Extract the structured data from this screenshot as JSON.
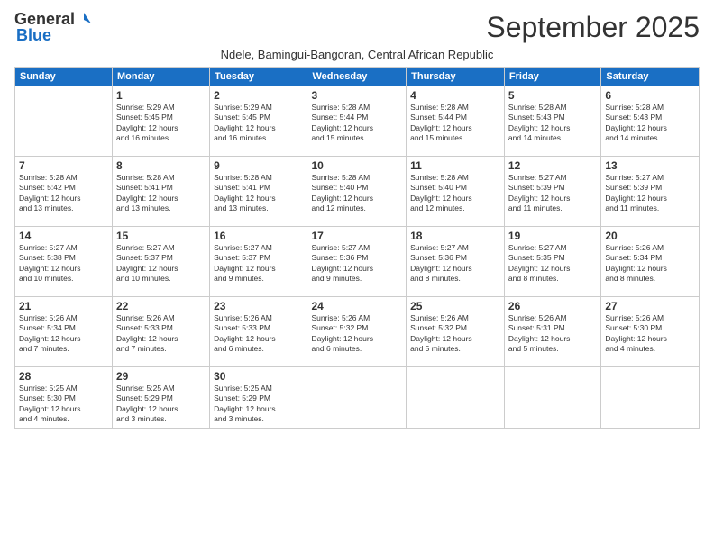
{
  "logo": {
    "general": "General",
    "blue": "Blue"
  },
  "title": "September 2025",
  "subtitle": "Ndele, Bamingui-Bangoran, Central African Republic",
  "days_of_week": [
    "Sunday",
    "Monday",
    "Tuesday",
    "Wednesday",
    "Thursday",
    "Friday",
    "Saturday"
  ],
  "weeks": [
    [
      {
        "day": "",
        "detail": ""
      },
      {
        "day": "1",
        "detail": "Sunrise: 5:29 AM\nSunset: 5:45 PM\nDaylight: 12 hours\nand 16 minutes."
      },
      {
        "day": "2",
        "detail": "Sunrise: 5:29 AM\nSunset: 5:45 PM\nDaylight: 12 hours\nand 16 minutes."
      },
      {
        "day": "3",
        "detail": "Sunrise: 5:28 AM\nSunset: 5:44 PM\nDaylight: 12 hours\nand 15 minutes."
      },
      {
        "day": "4",
        "detail": "Sunrise: 5:28 AM\nSunset: 5:44 PM\nDaylight: 12 hours\nand 15 minutes."
      },
      {
        "day": "5",
        "detail": "Sunrise: 5:28 AM\nSunset: 5:43 PM\nDaylight: 12 hours\nand 14 minutes."
      },
      {
        "day": "6",
        "detail": "Sunrise: 5:28 AM\nSunset: 5:43 PM\nDaylight: 12 hours\nand 14 minutes."
      }
    ],
    [
      {
        "day": "7",
        "detail": "Sunrise: 5:28 AM\nSunset: 5:42 PM\nDaylight: 12 hours\nand 13 minutes."
      },
      {
        "day": "8",
        "detail": "Sunrise: 5:28 AM\nSunset: 5:41 PM\nDaylight: 12 hours\nand 13 minutes."
      },
      {
        "day": "9",
        "detail": "Sunrise: 5:28 AM\nSunset: 5:41 PM\nDaylight: 12 hours\nand 13 minutes."
      },
      {
        "day": "10",
        "detail": "Sunrise: 5:28 AM\nSunset: 5:40 PM\nDaylight: 12 hours\nand 12 minutes."
      },
      {
        "day": "11",
        "detail": "Sunrise: 5:28 AM\nSunset: 5:40 PM\nDaylight: 12 hours\nand 12 minutes."
      },
      {
        "day": "12",
        "detail": "Sunrise: 5:27 AM\nSunset: 5:39 PM\nDaylight: 12 hours\nand 11 minutes."
      },
      {
        "day": "13",
        "detail": "Sunrise: 5:27 AM\nSunset: 5:39 PM\nDaylight: 12 hours\nand 11 minutes."
      }
    ],
    [
      {
        "day": "14",
        "detail": "Sunrise: 5:27 AM\nSunset: 5:38 PM\nDaylight: 12 hours\nand 10 minutes."
      },
      {
        "day": "15",
        "detail": "Sunrise: 5:27 AM\nSunset: 5:37 PM\nDaylight: 12 hours\nand 10 minutes."
      },
      {
        "day": "16",
        "detail": "Sunrise: 5:27 AM\nSunset: 5:37 PM\nDaylight: 12 hours\nand 9 minutes."
      },
      {
        "day": "17",
        "detail": "Sunrise: 5:27 AM\nSunset: 5:36 PM\nDaylight: 12 hours\nand 9 minutes."
      },
      {
        "day": "18",
        "detail": "Sunrise: 5:27 AM\nSunset: 5:36 PM\nDaylight: 12 hours\nand 8 minutes."
      },
      {
        "day": "19",
        "detail": "Sunrise: 5:27 AM\nSunset: 5:35 PM\nDaylight: 12 hours\nand 8 minutes."
      },
      {
        "day": "20",
        "detail": "Sunrise: 5:26 AM\nSunset: 5:34 PM\nDaylight: 12 hours\nand 8 minutes."
      }
    ],
    [
      {
        "day": "21",
        "detail": "Sunrise: 5:26 AM\nSunset: 5:34 PM\nDaylight: 12 hours\nand 7 minutes."
      },
      {
        "day": "22",
        "detail": "Sunrise: 5:26 AM\nSunset: 5:33 PM\nDaylight: 12 hours\nand 7 minutes."
      },
      {
        "day": "23",
        "detail": "Sunrise: 5:26 AM\nSunset: 5:33 PM\nDaylight: 12 hours\nand 6 minutes."
      },
      {
        "day": "24",
        "detail": "Sunrise: 5:26 AM\nSunset: 5:32 PM\nDaylight: 12 hours\nand 6 minutes."
      },
      {
        "day": "25",
        "detail": "Sunrise: 5:26 AM\nSunset: 5:32 PM\nDaylight: 12 hours\nand 5 minutes."
      },
      {
        "day": "26",
        "detail": "Sunrise: 5:26 AM\nSunset: 5:31 PM\nDaylight: 12 hours\nand 5 minutes."
      },
      {
        "day": "27",
        "detail": "Sunrise: 5:26 AM\nSunset: 5:30 PM\nDaylight: 12 hours\nand 4 minutes."
      }
    ],
    [
      {
        "day": "28",
        "detail": "Sunrise: 5:25 AM\nSunset: 5:30 PM\nDaylight: 12 hours\nand 4 minutes."
      },
      {
        "day": "29",
        "detail": "Sunrise: 5:25 AM\nSunset: 5:29 PM\nDaylight: 12 hours\nand 3 minutes."
      },
      {
        "day": "30",
        "detail": "Sunrise: 5:25 AM\nSunset: 5:29 PM\nDaylight: 12 hours\nand 3 minutes."
      },
      {
        "day": "",
        "detail": ""
      },
      {
        "day": "",
        "detail": ""
      },
      {
        "day": "",
        "detail": ""
      },
      {
        "day": "",
        "detail": ""
      }
    ]
  ]
}
